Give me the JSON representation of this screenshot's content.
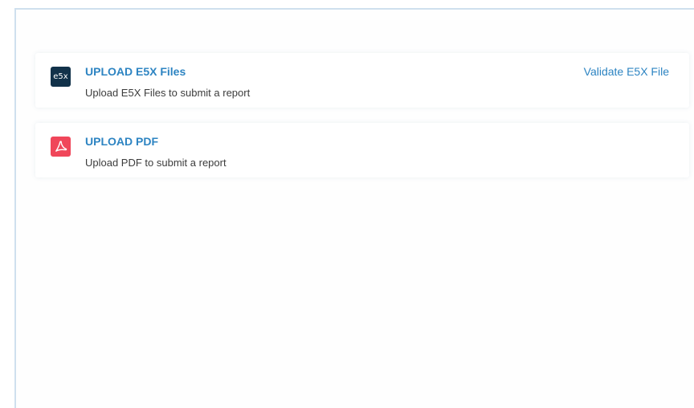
{
  "cards": [
    {
      "icon_text": "e5x",
      "icon_name": "e5x-file-icon",
      "title": "UPLOAD E5X Files",
      "description": "Upload E5X Files to submit a report",
      "action_label": "Validate E5X File"
    },
    {
      "icon_name": "pdf-file-icon",
      "title": "UPLOAD PDF",
      "description": "Upload PDF to submit a report"
    }
  ],
  "colors": {
    "accent": "#2d84c2",
    "e5x_icon_bg": "#12324a",
    "pdf_icon_bg": "#f0465a",
    "panel_border": "#cfe0ee"
  }
}
